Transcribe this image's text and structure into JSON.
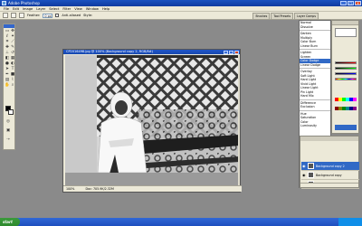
{
  "window": {
    "title": "Adobe Photoshop",
    "minimize": "_",
    "maximize": "□",
    "close": "×"
  },
  "menu": [
    "File",
    "Edit",
    "Image",
    "Layer",
    "Select",
    "Filter",
    "View",
    "Window",
    "Help"
  ],
  "options": {
    "feather_label": "Feather:",
    "feather_value": "0 px",
    "antialias_label": "Anti-aliased",
    "style_label": "Style:"
  },
  "wells": [
    "Brushes",
    "Tool Presets",
    "Layer Comps"
  ],
  "document": {
    "title": "CP2016498.jpg @ 100% (Background copy 2, RGB/8#)",
    "zoom": "100%",
    "doc_info": "Doc: 705.9K/2.32M"
  },
  "blend_modes": {
    "groups": [
      [
        "Normal",
        "Dissolve"
      ],
      [
        "Darken",
        "Multiply",
        "Color Burn",
        "Linear Burn"
      ],
      [
        "Lighten",
        "Screen",
        "Color Dodge",
        "Linear Dodge"
      ],
      [
        "Overlay",
        "Soft Light",
        "Hard Light",
        "Vivid Light",
        "Linear Light",
        "Pin Light",
        "Hard Mix"
      ],
      [
        "Difference",
        "Exclusion"
      ],
      [
        "Hue",
        "Saturation",
        "Color",
        "Luminosity"
      ]
    ],
    "selected": "Color Dodge"
  },
  "layers": [
    {
      "name": "Background copy 2",
      "selected": true
    },
    {
      "name": "Background copy",
      "selected": false
    },
    {
      "name": "Background",
      "selected": false
    }
  ],
  "colors": {
    "accent": "#3169c6",
    "titlebar": "#1a52c0",
    "chrome": "#ece9d8"
  },
  "taskbar": {
    "start": "start"
  }
}
